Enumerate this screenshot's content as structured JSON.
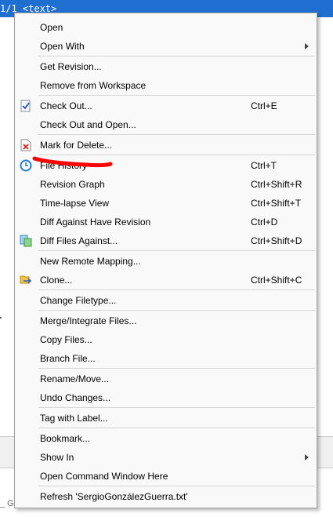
{
  "background": {
    "titlebar_text": "1/1 <text>",
    "bottom_text": "_ Go"
  },
  "menu": {
    "items": [
      {
        "label": "Open",
        "shortcut": "",
        "submenu": false
      },
      {
        "label": "Open With",
        "shortcut": "",
        "submenu": true
      },
      {
        "label": "Get Revision...",
        "shortcut": "",
        "submenu": false
      },
      {
        "label": "Remove from Workspace",
        "shortcut": "",
        "submenu": false
      },
      {
        "label": "Check Out...",
        "shortcut": "Ctrl+E",
        "submenu": false,
        "icon": "checkout-icon"
      },
      {
        "label": "Check Out and Open...",
        "shortcut": "",
        "submenu": false
      },
      {
        "label": "Mark for Delete...",
        "shortcut": "",
        "submenu": false,
        "icon": "delete-file-icon"
      },
      {
        "label": "File History",
        "shortcut": "Ctrl+T",
        "submenu": false,
        "icon": "history-clock-icon"
      },
      {
        "label": "Revision Graph",
        "shortcut": "Ctrl+Shift+R",
        "submenu": false
      },
      {
        "label": "Time-lapse View",
        "shortcut": "Ctrl+Shift+T",
        "submenu": false
      },
      {
        "label": "Diff Against Have Revision",
        "shortcut": "Ctrl+D",
        "submenu": false
      },
      {
        "label": "Diff Files Against...",
        "shortcut": "Ctrl+Shift+D",
        "submenu": false,
        "icon": "diff-files-icon"
      },
      {
        "label": "New Remote Mapping...",
        "shortcut": "",
        "submenu": false
      },
      {
        "label": "Clone...",
        "shortcut": "Ctrl+Shift+C",
        "submenu": false,
        "icon": "clone-icon"
      },
      {
        "label": "Change Filetype...",
        "shortcut": "",
        "submenu": false
      },
      {
        "label": "Merge/Integrate Files...",
        "shortcut": "",
        "submenu": false
      },
      {
        "label": "Copy Files...",
        "shortcut": "",
        "submenu": false
      },
      {
        "label": "Branch File...",
        "shortcut": "",
        "submenu": false
      },
      {
        "label": "Rename/Move...",
        "shortcut": "",
        "submenu": false
      },
      {
        "label": "Undo Changes...",
        "shortcut": "",
        "submenu": false
      },
      {
        "label": "Tag with Label...",
        "shortcut": "",
        "submenu": false
      },
      {
        "label": "Bookmark...",
        "shortcut": "",
        "submenu": false
      },
      {
        "label": "Show In",
        "shortcut": "",
        "submenu": true
      },
      {
        "label": "Open Command Window Here",
        "shortcut": "",
        "submenu": false
      },
      {
        "label": "Refresh 'SergioGonzálezGuerra.txt'",
        "shortcut": "",
        "submenu": false
      }
    ]
  },
  "colors": {
    "titlebar": "#1f6fd1",
    "menu_bg": "#f9f9f9",
    "annotation_red": "#ff0000"
  }
}
